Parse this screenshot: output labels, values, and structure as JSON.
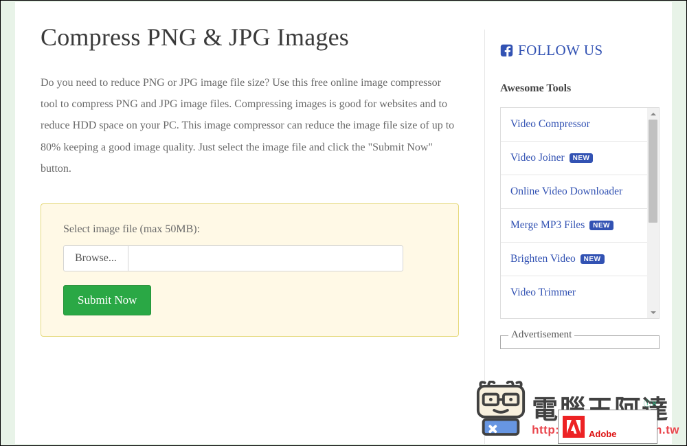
{
  "main": {
    "title": "Compress PNG & JPG Images",
    "description": "Do you need to reduce PNG or JPG image file size? Use this free online image compressor tool to compress PNG and JPG image files. Compressing images is good for websites and to reduce HDD space on your PC. This image compressor can reduce the image file size of up to 80% keeping a good image quality. Just select the image file and click the \"Submit Now\" button.",
    "upload": {
      "label": "Select image file (max 50MB):",
      "browse": "Browse...",
      "filename": "",
      "submit": "Submit Now"
    }
  },
  "sidebar": {
    "follow_label": "FOLLOW US",
    "tools_heading": "Awesome Tools",
    "tools": [
      {
        "label": "Video Compressor",
        "new": false
      },
      {
        "label": "Video Joiner",
        "new": true
      },
      {
        "label": "Online Video Downloader",
        "new": false
      },
      {
        "label": "Merge MP3 Files",
        "new": true
      },
      {
        "label": "Brighten Video",
        "new": true
      },
      {
        "label": "Video Trimmer",
        "new": false
      }
    ],
    "new_badge": "NEW",
    "ad_label": "Advertisement"
  },
  "watermark": {
    "cn": "電腦王阿達",
    "url": "http://www.kocpc.com.tw"
  },
  "ad": {
    "close": "ⓘ✕",
    "brand": "Adobe"
  }
}
